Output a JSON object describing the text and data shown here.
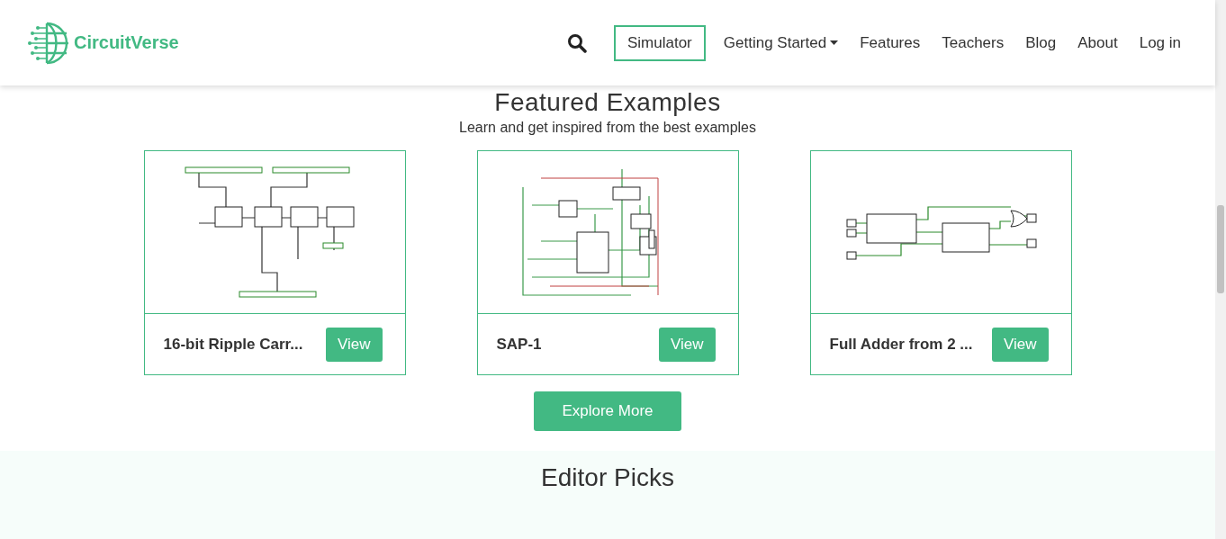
{
  "navbar": {
    "brand": "CircuitVerse",
    "items": [
      {
        "kind": "search"
      },
      {
        "kind": "outlined",
        "label": "Simulator"
      },
      {
        "kind": "dropdown",
        "label": "Getting Started"
      },
      {
        "kind": "link",
        "label": "Features"
      },
      {
        "kind": "link",
        "label": "Teachers"
      },
      {
        "kind": "link",
        "label": "Blog"
      },
      {
        "kind": "link",
        "label": "About"
      },
      {
        "kind": "link",
        "label": "Log in"
      }
    ]
  },
  "featured": {
    "title": "Featured Examples",
    "subtitle": "Learn and get inspired from the best examples",
    "cards": [
      {
        "title": "16-bit Ripple Carr...",
        "button": "View"
      },
      {
        "title": "SAP-1",
        "button": "View"
      },
      {
        "title": "Full Adder from 2 ...",
        "button": "View"
      }
    ],
    "more": "Explore More"
  },
  "editor_picks": {
    "title": "Editor Picks"
  }
}
